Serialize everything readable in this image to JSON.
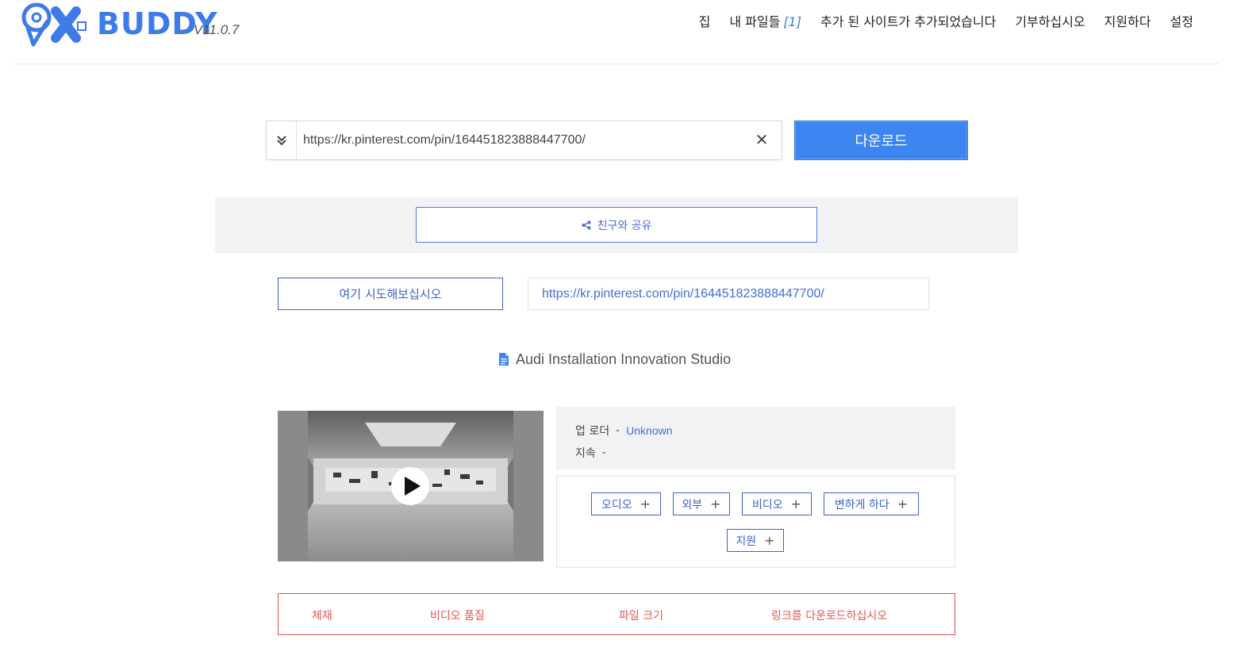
{
  "app": {
    "logo_text": "BUDDY",
    "version": "V11.0.7"
  },
  "nav": {
    "items": [
      {
        "label": "집"
      },
      {
        "label": "내 파일들",
        "count": "[1]"
      },
      {
        "label": "추가 된 사이트가 추가되었습니다"
      },
      {
        "label": "기부하십시오"
      },
      {
        "label": "지원하다"
      },
      {
        "label": "설정"
      }
    ]
  },
  "search": {
    "url_value": "https://kr.pinterest.com/pin/164451823888447700/",
    "clear_symbol": "✕",
    "download_label": "다운로드"
  },
  "share": {
    "label": "친구와 공유"
  },
  "try_here": {
    "button_label": "여기 시도해보십시오",
    "link_text": "https://kr.pinterest.com/pin/164451823888447700/"
  },
  "media": {
    "title": "Audi Installation Innovation Studio",
    "uploader_label": "업 로더",
    "uploader_sep": "-",
    "uploader_value": "Unknown",
    "duration_label": "지속",
    "duration_sep": "-"
  },
  "options": {
    "buttons": [
      {
        "label": "오디오",
        "plus": "+"
      },
      {
        "label": "외부",
        "plus": "+"
      },
      {
        "label": "비디오",
        "plus": "+"
      },
      {
        "label": "변하게 하다",
        "plus": "+"
      },
      {
        "label": "지원",
        "plus": "+"
      }
    ]
  },
  "format_table": {
    "columns": [
      "체재",
      "비디오 품질",
      "파일 크기",
      "링크를 다운로드하십시오"
    ]
  },
  "colors": {
    "brand_blue": "#3d7be8",
    "download_btn": "#3d85f0",
    "table_red": "#e05050",
    "panel_gray": "#f1f2f4"
  }
}
